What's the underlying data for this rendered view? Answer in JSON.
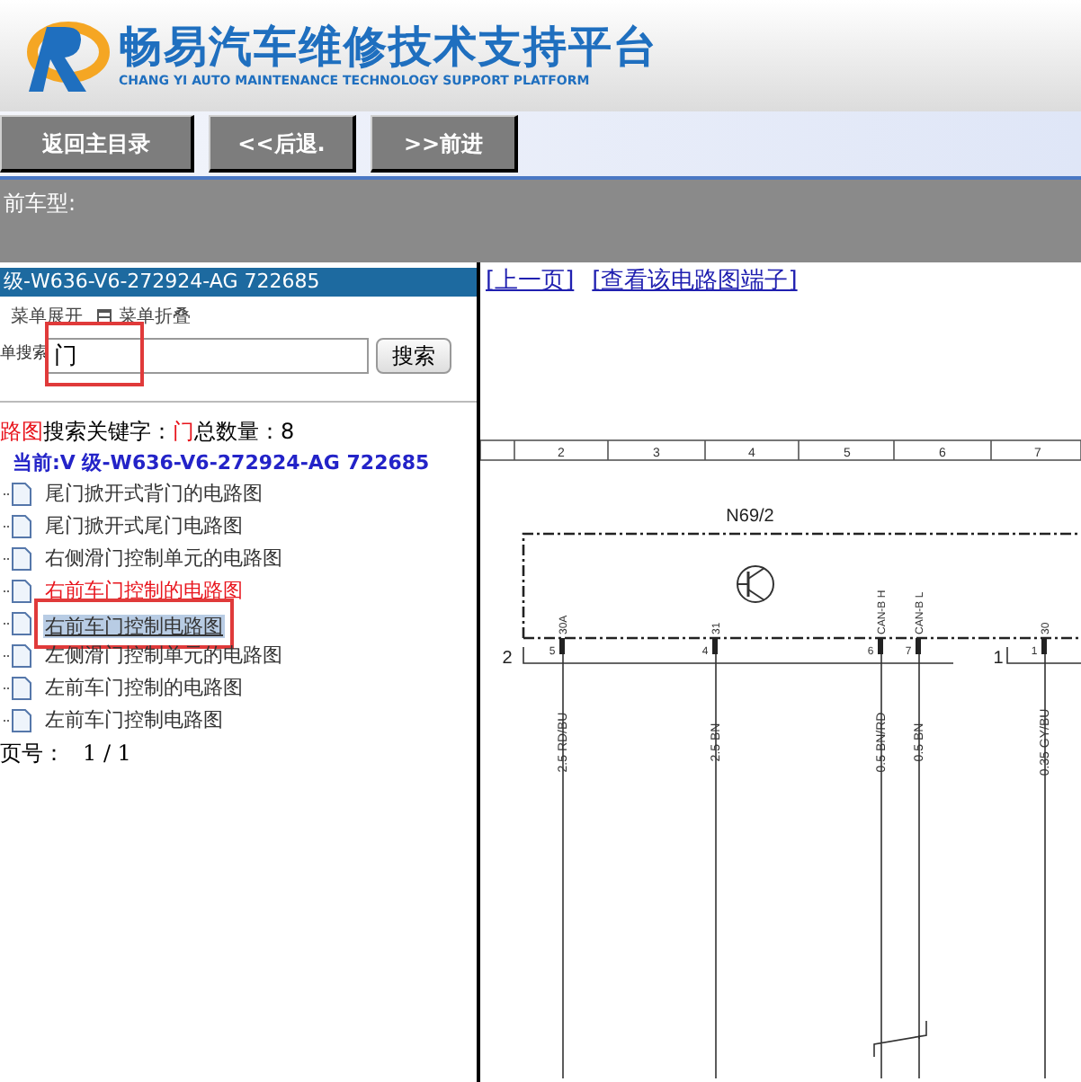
{
  "header": {
    "title": "畅易汽车维修技术支持平台",
    "subtitle": "CHANG YI AUTO MAINTENANCE TECHNOLOGY SUPPORT PLATFORM"
  },
  "nav_buttons": [
    "返回主目录",
    "<<后退.",
    ">>前进"
  ],
  "model_bar": {
    "label": "前车型:"
  },
  "sidebar": {
    "title": "级-W636-V6-272924-AG 722685",
    "menu_options": [
      {
        "label": "菜单展开"
      },
      {
        "label": "菜单折叠"
      }
    ],
    "search": {
      "label": "单搜索",
      "value": "门",
      "button": "搜索"
    },
    "result": {
      "prefix": "路图",
      "keyword_label": "搜索关键字：",
      "keyword": "门",
      "count_label": "总数量：",
      "count": "8"
    },
    "current": "当前:V 级-W636-V6-272924-AG 722685",
    "items": [
      {
        "label": "尾门掀开式背门的电路图",
        "selected": false,
        "color": "#333333"
      },
      {
        "label": "尾门掀开式尾门电路图",
        "selected": false,
        "color": "#333333"
      },
      {
        "label": "右侧滑门控制单元的电路图",
        "selected": false,
        "color": "#333333"
      },
      {
        "label": "右前车门控制的电路图",
        "selected": false,
        "color": "#e8141c"
      },
      {
        "label": "右前车门控制电路图",
        "selected": true,
        "color": "#333333"
      },
      {
        "label": "左侧滑门控制单元的电路图",
        "selected": false,
        "color": "#333333"
      },
      {
        "label": "左前车门控制的电路图",
        "selected": false,
        "color": "#333333"
      },
      {
        "label": "左前车门控制电路图",
        "selected": false,
        "color": "#333333"
      }
    ],
    "pager": {
      "label": "页号：",
      "value": "1 / 1"
    }
  },
  "viewer": {
    "links": [
      "[上一页]",
      "[查看该电路图端子]"
    ],
    "diagram": {
      "columns": [
        "2",
        "3",
        "4",
        "5",
        "6",
        "7"
      ],
      "component": "N69/2",
      "connectors": [
        {
          "label": "2"
        },
        {
          "label": "1"
        }
      ],
      "pins": [
        {
          "number": "5",
          "name": "30A",
          "wire": "2.5 RD/BU"
        },
        {
          "number": "4",
          "name": "31",
          "wire": "2.5 BN"
        },
        {
          "number": "6",
          "name": "CAN-B H",
          "wire": "0.5 BN/RD"
        },
        {
          "number": "7",
          "name": "CAN-B L",
          "wire": "0.5 BN"
        },
        {
          "number": "1",
          "name": "30",
          "wire": "0.35 GY/BU"
        }
      ]
    }
  }
}
